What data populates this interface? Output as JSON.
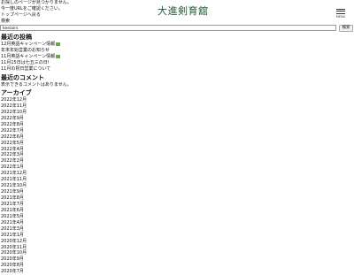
{
  "notice": {
    "line1": "お探しのページが見つかりません。",
    "line2": "今一度URLをご確認ください。",
    "line3": "トップページへ戻る"
  },
  "header": {
    "logo": "大進剣育舘",
    "menu_label": "MENU"
  },
  "search": {
    "label": "検索",
    "value": "keeiairs",
    "button": "検索"
  },
  "recent_posts": {
    "title": "最近の投稿",
    "items": [
      {
        "label": "12月英語キャンペーン情報",
        "badge": true
      },
      {
        "label": "年末年始営業のお知らせ",
        "badge": false
      },
      {
        "label": "11月英語キャンペーン情報",
        "badge": true
      },
      {
        "label": "11月15日は七五三の日!",
        "badge": false
      },
      {
        "label": "11月の祝日営業について",
        "badge": false
      }
    ]
  },
  "recent_comments": {
    "title": "最近のコメント",
    "empty": "表示できるコメントはありません。"
  },
  "archive": {
    "title": "アーカイブ",
    "items": [
      "2022年12月",
      "2022年11月",
      "2022年10月",
      "2022年9月",
      "2022年8月",
      "2022年7月",
      "2022年6月",
      "2022年5月",
      "2022年4月",
      "2022年3月",
      "2022年2月",
      "2022年1月",
      "2021年12月",
      "2021年11月",
      "2021年10月",
      "2021年9月",
      "2021年8月",
      "2021年7月",
      "2021年6月",
      "2021年5月",
      "2021年4月",
      "2021年3月",
      "2021年1月",
      "2020年12月",
      "2020年11月",
      "2020年10月",
      "2020年9月",
      "2020年8月",
      "2020年7月"
    ]
  }
}
